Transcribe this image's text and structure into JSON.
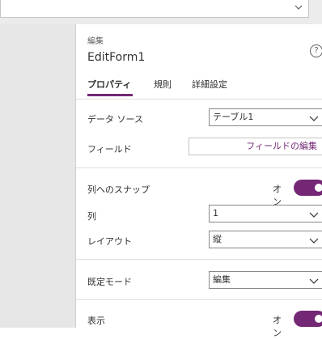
{
  "header": {
    "dropdown_value": ""
  },
  "panel": {
    "type_label": "編集",
    "title": "EditForm1",
    "help_glyph": "?",
    "tabs": [
      {
        "label": "プロパティ",
        "active": true
      },
      {
        "label": "規則",
        "active": false
      },
      {
        "label": "詳細設定",
        "active": false
      }
    ]
  },
  "properties": {
    "data_source": {
      "label": "データ ソース",
      "value": "テーブル1"
    },
    "fields": {
      "label": "フィールド",
      "button": "フィールドの編集"
    },
    "snap_to_columns": {
      "label": "列へのスナップ",
      "state": "オン",
      "on": true
    },
    "columns": {
      "label": "列",
      "value": "1"
    },
    "layout": {
      "label": "レイアウト",
      "value": "縦"
    },
    "default_mode": {
      "label": "既定モード",
      "value": "編集"
    },
    "visible": {
      "label": "表示",
      "state": "オン",
      "on": true
    }
  },
  "colors": {
    "accent": "#742774",
    "left_pane": "#e6e6e6"
  },
  "icons": {
    "chevron": "chevron-down-icon",
    "help": "help-icon"
  }
}
